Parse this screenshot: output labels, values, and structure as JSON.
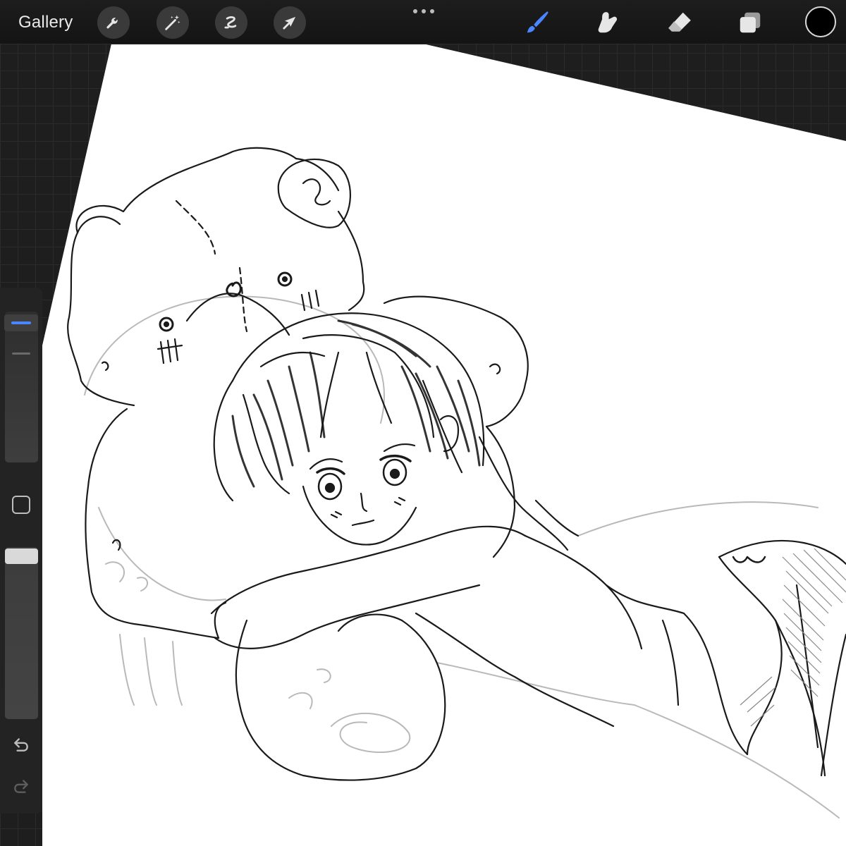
{
  "toolbar": {
    "gallery_label": "Gallery",
    "left_tools": [
      "wrench-icon",
      "magic-wand-icon",
      "selection-icon",
      "transform-arrow-icon"
    ],
    "right_tools": [
      "brush-icon",
      "smudge-icon",
      "eraser-icon",
      "layers-icon"
    ],
    "active_tool": "brush-icon",
    "active_color": "#000000",
    "accent_color": "#4a86ff"
  },
  "sidebar": {
    "brush_size": 0.05,
    "brush_opacity": 1.0
  }
}
